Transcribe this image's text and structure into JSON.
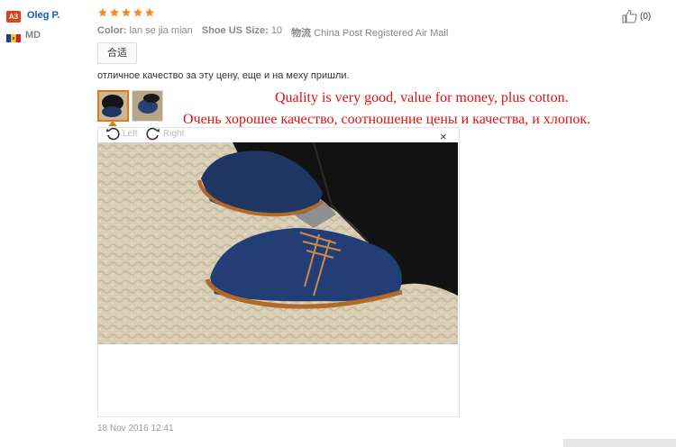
{
  "user": {
    "badge": "A3",
    "name": "Oleg P.",
    "country": "MD",
    "badge_color": "#e0401c"
  },
  "review": {
    "rating": 5,
    "rating_max": 5,
    "star_color": "#f08a24",
    "color_label": "Color:",
    "color_value": "lan se jia mian",
    "size_label": "Shoe US Size:",
    "size_value": "10",
    "shipping_label": "物流",
    "shipping_value": "China Post Registered Air Mail",
    "tag": "合适",
    "text": "отличное качество за эту цену, еще и на меху пришли.",
    "likes": "(0)",
    "date": "18 Nov 2016 12:41"
  },
  "translations": {
    "english": "Quality is very good, value for money, plus cotton.",
    "russian": "Очень хорошее качество, соотношение цены и качества, и хлопок.",
    "color": "#e01010"
  },
  "viewer": {
    "rotate_left": "Left",
    "rotate_right": "Right",
    "close": "×"
  },
  "icons": [
    "thumbs-up-icon",
    "rotate-left-icon",
    "rotate-right-icon",
    "close-icon",
    "star-icon",
    "flag-icon"
  ]
}
